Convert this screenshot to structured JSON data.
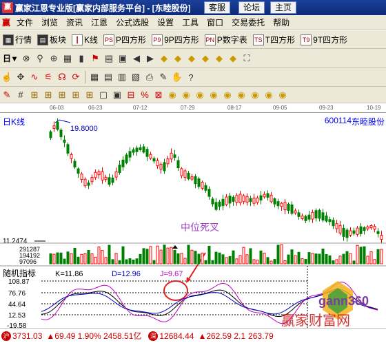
{
  "window": {
    "title": "赢家江恩专业版[赢家内部服务平台] - [东睦股份]",
    "logo": "赢",
    "buttons": [
      "客服",
      "论坛",
      "主页"
    ]
  },
  "menu": [
    "文件",
    "浏览",
    "资讯",
    "江恩",
    "公式选股",
    "设置",
    "工具",
    "窗口",
    "交易委托",
    "帮助"
  ],
  "toolbar1": [
    {
      "label": "行情",
      "icon": "grid-icon"
    },
    {
      "label": "板块",
      "icon": "blocks-icon"
    },
    {
      "label": "K线",
      "icon": "candlestick-icon"
    },
    {
      "label": "P四方形",
      "icon": "ps-icon",
      "tag": "PS"
    },
    {
      "label": "9P四方形",
      "icon": "p9-icon",
      "tag": "P9"
    },
    {
      "label": "P数字表",
      "icon": "pn-icon",
      "tag": "PN"
    },
    {
      "label": "T四方形",
      "icon": "ts-icon",
      "tag": "TS"
    },
    {
      "label": "9T四方形",
      "icon": "t9-icon",
      "tag": "T9"
    }
  ],
  "toolbar2_period": "日",
  "chart": {
    "kline_label": "日K线",
    "stock_code": "600114",
    "stock_name": "东睦股份",
    "dates": [
      "06-03",
      "06-23",
      "07-12",
      "07-29",
      "08-17",
      "09-05",
      "09-23",
      "10-19"
    ],
    "high_label": "19.8000",
    "low_label": "11.2474",
    "annotation": "中位死叉",
    "volume_labels": [
      "291287",
      "194192",
      "97096"
    ],
    "indicator_title": "随机指标",
    "k_label": "K=11.86",
    "d_label": "D=12.96",
    "j_label": "J=9.67",
    "indicator_ticks": [
      "108.87",
      "76.76",
      "44.64",
      "12.53",
      "-19.58"
    ],
    "watermark": "赢家财富网",
    "logo_text": "gann360",
    "colors": {
      "up": "#ff0000",
      "down": "#008000",
      "k": "#000000",
      "d": "#0000c0",
      "j": "#c000c0",
      "annotation": "#a040c0"
    }
  },
  "status": {
    "sh_index": "3731.03",
    "sh_change": "▲69.49 1.90% 2458.51亿",
    "sz_index": "12684.44",
    "sz_change": "▲262.59 2.1",
    "tail": "263.79"
  }
}
